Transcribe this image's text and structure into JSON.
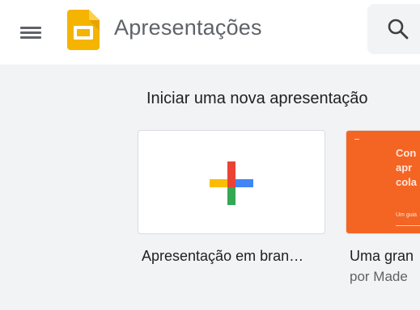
{
  "app": {
    "title": "Apresentações",
    "logo_icon": "google-slides-logo-icon",
    "menu_icon": "hamburger-menu-icon",
    "search_icon": "search-icon"
  },
  "colors": {
    "brand_yellow": "#f4b400",
    "topbar_bg": "#ffffff",
    "page_bg": "#f1f3f4",
    "template_orange": "#f46524"
  },
  "templates": {
    "section_title": "Iniciar uma nova apresentação",
    "items": [
      {
        "label": "Apresentação em bran…",
        "thumbnail_icon": "plus-icon"
      },
      {
        "label": "Uma gran",
        "author": "por Made",
        "thumbnail_text": "Con\napr\ncola",
        "thumbnail_small_text": "Um guia"
      }
    ]
  }
}
